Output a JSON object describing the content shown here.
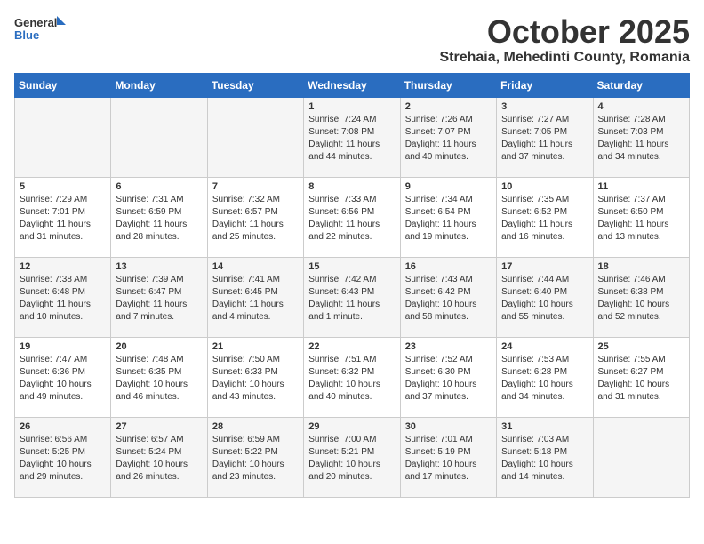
{
  "header": {
    "logo_general": "General",
    "logo_blue": "Blue",
    "month": "October 2025",
    "location": "Strehaia, Mehedinti County, Romania"
  },
  "weekdays": [
    "Sunday",
    "Monday",
    "Tuesday",
    "Wednesday",
    "Thursday",
    "Friday",
    "Saturday"
  ],
  "weeks": [
    [
      {
        "day": "",
        "info": ""
      },
      {
        "day": "",
        "info": ""
      },
      {
        "day": "",
        "info": ""
      },
      {
        "day": "1",
        "info": "Sunrise: 7:24 AM\nSunset: 7:08 PM\nDaylight: 11 hours\nand 44 minutes."
      },
      {
        "day": "2",
        "info": "Sunrise: 7:26 AM\nSunset: 7:07 PM\nDaylight: 11 hours\nand 40 minutes."
      },
      {
        "day": "3",
        "info": "Sunrise: 7:27 AM\nSunset: 7:05 PM\nDaylight: 11 hours\nand 37 minutes."
      },
      {
        "day": "4",
        "info": "Sunrise: 7:28 AM\nSunset: 7:03 PM\nDaylight: 11 hours\nand 34 minutes."
      }
    ],
    [
      {
        "day": "5",
        "info": "Sunrise: 7:29 AM\nSunset: 7:01 PM\nDaylight: 11 hours\nand 31 minutes."
      },
      {
        "day": "6",
        "info": "Sunrise: 7:31 AM\nSunset: 6:59 PM\nDaylight: 11 hours\nand 28 minutes."
      },
      {
        "day": "7",
        "info": "Sunrise: 7:32 AM\nSunset: 6:57 PM\nDaylight: 11 hours\nand 25 minutes."
      },
      {
        "day": "8",
        "info": "Sunrise: 7:33 AM\nSunset: 6:56 PM\nDaylight: 11 hours\nand 22 minutes."
      },
      {
        "day": "9",
        "info": "Sunrise: 7:34 AM\nSunset: 6:54 PM\nDaylight: 11 hours\nand 19 minutes."
      },
      {
        "day": "10",
        "info": "Sunrise: 7:35 AM\nSunset: 6:52 PM\nDaylight: 11 hours\nand 16 minutes."
      },
      {
        "day": "11",
        "info": "Sunrise: 7:37 AM\nSunset: 6:50 PM\nDaylight: 11 hours\nand 13 minutes."
      }
    ],
    [
      {
        "day": "12",
        "info": "Sunrise: 7:38 AM\nSunset: 6:48 PM\nDaylight: 11 hours\nand 10 minutes."
      },
      {
        "day": "13",
        "info": "Sunrise: 7:39 AM\nSunset: 6:47 PM\nDaylight: 11 hours\nand 7 minutes."
      },
      {
        "day": "14",
        "info": "Sunrise: 7:41 AM\nSunset: 6:45 PM\nDaylight: 11 hours\nand 4 minutes."
      },
      {
        "day": "15",
        "info": "Sunrise: 7:42 AM\nSunset: 6:43 PM\nDaylight: 11 hours\nand 1 minute."
      },
      {
        "day": "16",
        "info": "Sunrise: 7:43 AM\nSunset: 6:42 PM\nDaylight: 10 hours\nand 58 minutes."
      },
      {
        "day": "17",
        "info": "Sunrise: 7:44 AM\nSunset: 6:40 PM\nDaylight: 10 hours\nand 55 minutes."
      },
      {
        "day": "18",
        "info": "Sunrise: 7:46 AM\nSunset: 6:38 PM\nDaylight: 10 hours\nand 52 minutes."
      }
    ],
    [
      {
        "day": "19",
        "info": "Sunrise: 7:47 AM\nSunset: 6:36 PM\nDaylight: 10 hours\nand 49 minutes."
      },
      {
        "day": "20",
        "info": "Sunrise: 7:48 AM\nSunset: 6:35 PM\nDaylight: 10 hours\nand 46 minutes."
      },
      {
        "day": "21",
        "info": "Sunrise: 7:50 AM\nSunset: 6:33 PM\nDaylight: 10 hours\nand 43 minutes."
      },
      {
        "day": "22",
        "info": "Sunrise: 7:51 AM\nSunset: 6:32 PM\nDaylight: 10 hours\nand 40 minutes."
      },
      {
        "day": "23",
        "info": "Sunrise: 7:52 AM\nSunset: 6:30 PM\nDaylight: 10 hours\nand 37 minutes."
      },
      {
        "day": "24",
        "info": "Sunrise: 7:53 AM\nSunset: 6:28 PM\nDaylight: 10 hours\nand 34 minutes."
      },
      {
        "day": "25",
        "info": "Sunrise: 7:55 AM\nSunset: 6:27 PM\nDaylight: 10 hours\nand 31 minutes."
      }
    ],
    [
      {
        "day": "26",
        "info": "Sunrise: 6:56 AM\nSunset: 5:25 PM\nDaylight: 10 hours\nand 29 minutes."
      },
      {
        "day": "27",
        "info": "Sunrise: 6:57 AM\nSunset: 5:24 PM\nDaylight: 10 hours\nand 26 minutes."
      },
      {
        "day": "28",
        "info": "Sunrise: 6:59 AM\nSunset: 5:22 PM\nDaylight: 10 hours\nand 23 minutes."
      },
      {
        "day": "29",
        "info": "Sunrise: 7:00 AM\nSunset: 5:21 PM\nDaylight: 10 hours\nand 20 minutes."
      },
      {
        "day": "30",
        "info": "Sunrise: 7:01 AM\nSunset: 5:19 PM\nDaylight: 10 hours\nand 17 minutes."
      },
      {
        "day": "31",
        "info": "Sunrise: 7:03 AM\nSunset: 5:18 PM\nDaylight: 10 hours\nand 14 minutes."
      },
      {
        "day": "",
        "info": ""
      }
    ]
  ]
}
